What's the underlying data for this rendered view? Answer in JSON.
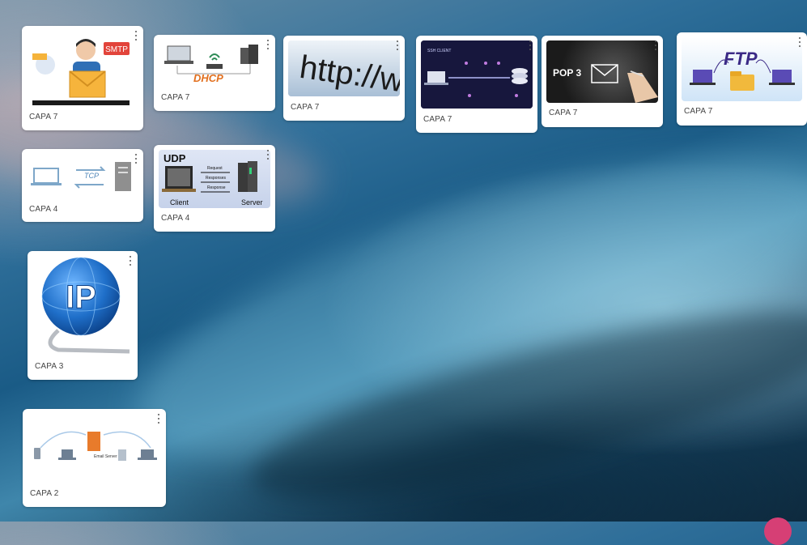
{
  "board": {
    "cards": [
      {
        "id": "smtp",
        "label": "CAPA 7",
        "image_text": "SMTP"
      },
      {
        "id": "dhcp",
        "label": "CAPA 7",
        "image_text": "DHCP"
      },
      {
        "id": "http",
        "label": "CAPA 7",
        "image_text": "http://ww"
      },
      {
        "id": "ssh",
        "label": "CAPA 7",
        "image_text": "SSH CLIENT"
      },
      {
        "id": "pop3",
        "label": "CAPA 7",
        "image_text": "POP 3"
      },
      {
        "id": "ftp",
        "label": "CAPA 7",
        "image_text": "FTP"
      },
      {
        "id": "tcp",
        "label": "CAPA 4",
        "image_text": "TCP"
      },
      {
        "id": "udp",
        "label": "CAPA 4",
        "image_text": "UDP",
        "image_sub": {
          "client": "Client",
          "server": "Server",
          "request": "Request",
          "responses": "Responses",
          "response": "Response"
        }
      },
      {
        "id": "ip",
        "label": "CAPA 3",
        "image_text": "IP"
      },
      {
        "id": "email",
        "label": "CAPA 2",
        "image_text": "Email Server"
      }
    ]
  },
  "colors": {
    "card_bg": "#ffffff",
    "label_text": "#444444",
    "fab": "#d63f75"
  }
}
